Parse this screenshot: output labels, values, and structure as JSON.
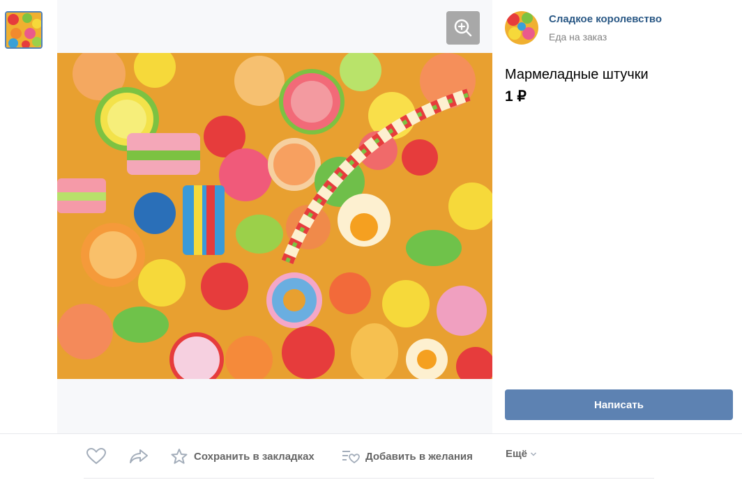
{
  "shop": {
    "name": "Сладкое королевство",
    "category": "Еда на заказ"
  },
  "product": {
    "title": "Мармеладные штучки",
    "price": "1 ₽"
  },
  "buttons": {
    "write": "Написать"
  },
  "actions": {
    "save": "Сохранить в закладках",
    "wishlist": "Добавить в желания",
    "more": "Ещё"
  },
  "icons": {
    "zoom": "zoom-in-icon",
    "like": "heart-icon",
    "share": "share-arrow-icon",
    "save": "star-icon",
    "wishlist": "wishlist-icon",
    "more": "chevron-down-icon"
  },
  "colors": {
    "link": "#2a5885",
    "button": "#5d82b2",
    "muted": "#828282",
    "thumb_border": "#5181b8"
  }
}
